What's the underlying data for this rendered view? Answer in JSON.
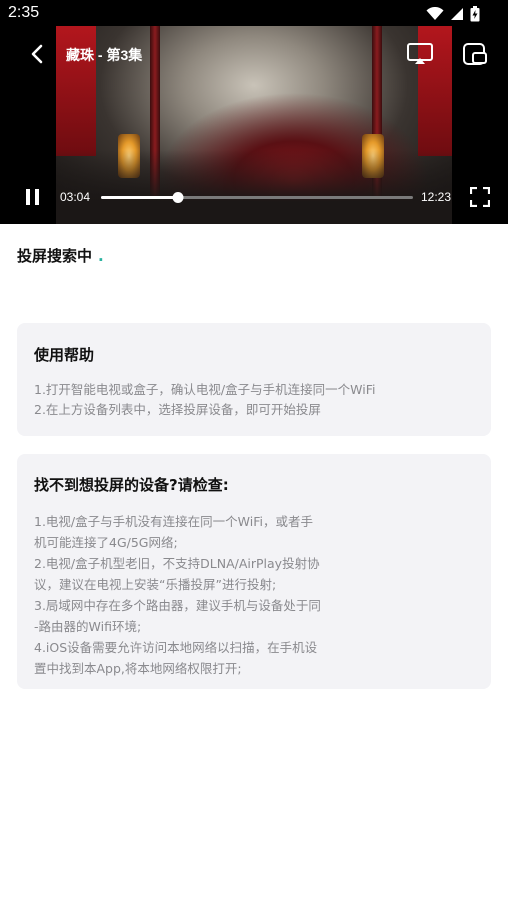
{
  "status_bar": {
    "time": "2:35"
  },
  "player": {
    "title": "藏珠 - 第3集",
    "current_time": "03:04",
    "total_time": "12:23",
    "progress": 0.248
  },
  "search_status": {
    "label": "投屏搜索中",
    "indicator": "."
  },
  "help_card": {
    "title": "使用帮助",
    "lines": [
      "1.打开智能电视或盒子，确认电视/盒子与手机连接同一个WiFi",
      "2.在上方设备列表中，选择投屏设备，即可开始投屏"
    ]
  },
  "troubleshoot_card": {
    "title": "找不到想投屏的设备?请检查:",
    "lines": [
      "1.电视/盒子与手机没有连接在同一个WiFi，或者手",
      "机可能连接了4G/5G网络;",
      "2.电视/盒子机型老旧，不支持DLNA/AirPlay投射协",
      "议，建议在电视上安装“乐播投屏”进行投射;",
      "3.局域网中存在多个路由器，建议手机与设备处于同",
      "-路由器的Wifi环境;",
      "4.iOS设备需要允许访问本地网络以扫描，在手机设",
      "置中找到本App,将本地网络权限打开;"
    ]
  },
  "colors": {
    "accent_dot": "#2bb3a0",
    "card_bg": "#f3f3f6",
    "muted_text": "#8a8a8e"
  },
  "icons": [
    "wifi-icon",
    "signal-icon",
    "battery-icon",
    "back-icon",
    "cast-icon",
    "pip-icon",
    "pause-icon",
    "fullscreen-icon"
  ]
}
